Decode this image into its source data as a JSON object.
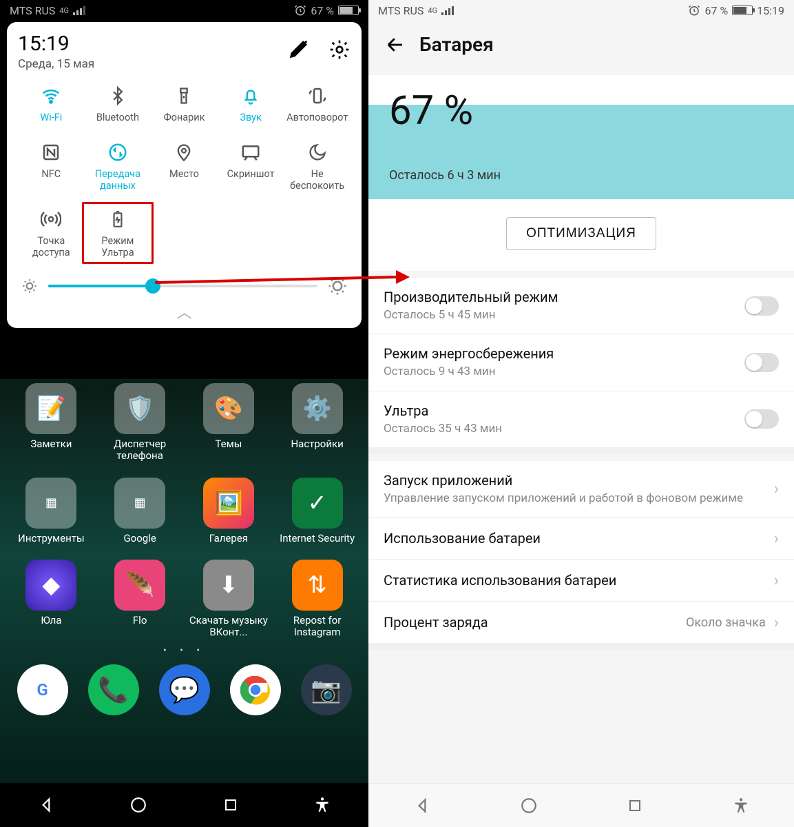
{
  "left": {
    "status": {
      "carrier": "MTS RUS",
      "net": "4G",
      "battery_pct": "67 %"
    },
    "qs": {
      "time": "15:19",
      "date": "Среда, 15 мая",
      "tiles": [
        {
          "label": "Wi-Fi",
          "active": true,
          "icon": "wifi"
        },
        {
          "label": "Bluetooth",
          "active": false,
          "icon": "bluetooth"
        },
        {
          "label": "Фонарик",
          "active": false,
          "icon": "flashlight"
        },
        {
          "label": "Звук",
          "active": true,
          "icon": "bell"
        },
        {
          "label": "Автоповорот",
          "active": false,
          "icon": "rotate"
        },
        {
          "label": "NFC",
          "active": false,
          "icon": "nfc"
        },
        {
          "label": "Передача данных",
          "active": true,
          "icon": "data"
        },
        {
          "label": "Место",
          "active": false,
          "icon": "location"
        },
        {
          "label": "Скриншот",
          "active": false,
          "icon": "screenshot"
        },
        {
          "label": "Не беспокоить",
          "active": false,
          "icon": "moon"
        },
        {
          "label": "Точка доступа",
          "active": false,
          "icon": "hotspot"
        },
        {
          "label": "Режим Ультра",
          "active": false,
          "icon": "ultra",
          "highlight": true
        }
      ],
      "brightness_pct": 38
    },
    "home": {
      "apps_row1": [
        {
          "label": "Заметки"
        },
        {
          "label": "Диспетчер телефона"
        },
        {
          "label": "Темы"
        },
        {
          "label": "Настройки"
        }
      ],
      "apps_row2": [
        {
          "label": "Инструменты"
        },
        {
          "label": "Google"
        },
        {
          "label": "Галерея"
        },
        {
          "label": "Internet Security"
        }
      ],
      "apps_row3": [
        {
          "label": "Юла"
        },
        {
          "label": "Flo"
        },
        {
          "label": "Скачать музыку ВКонт..."
        },
        {
          "label": "Repost for Instagram"
        }
      ],
      "dock": [
        "GPay",
        "Phone",
        "Messages",
        "Chrome",
        "Camera"
      ]
    }
  },
  "right": {
    "status": {
      "carrier": "MTS RUS",
      "net": "4G",
      "battery_pct": "67 %",
      "time": "15:19"
    },
    "title": "Батарея",
    "battery_pct": "67 %",
    "remaining": "Осталось 6 ч 3 мин",
    "optimize": "ОПТИМИЗАЦИЯ",
    "modes": [
      {
        "title": "Производительный режим",
        "sub": "Осталось 5 ч 45 мин"
      },
      {
        "title": "Режим энергосбережения",
        "sub": "Осталось 9 ч 43 мин"
      },
      {
        "title": "Ультра",
        "sub": "Осталось 35 ч 43 мин"
      }
    ],
    "items": [
      {
        "title": "Запуск приложений",
        "sub": "Управление запуском приложений и работой в фоновом режиме",
        "chev": true
      },
      {
        "title": "Использование батареи",
        "chev": true
      },
      {
        "title": "Статистика использования батареи",
        "chev": true
      },
      {
        "title": "Процент заряда",
        "value": "Около значка",
        "chev": true
      }
    ]
  }
}
